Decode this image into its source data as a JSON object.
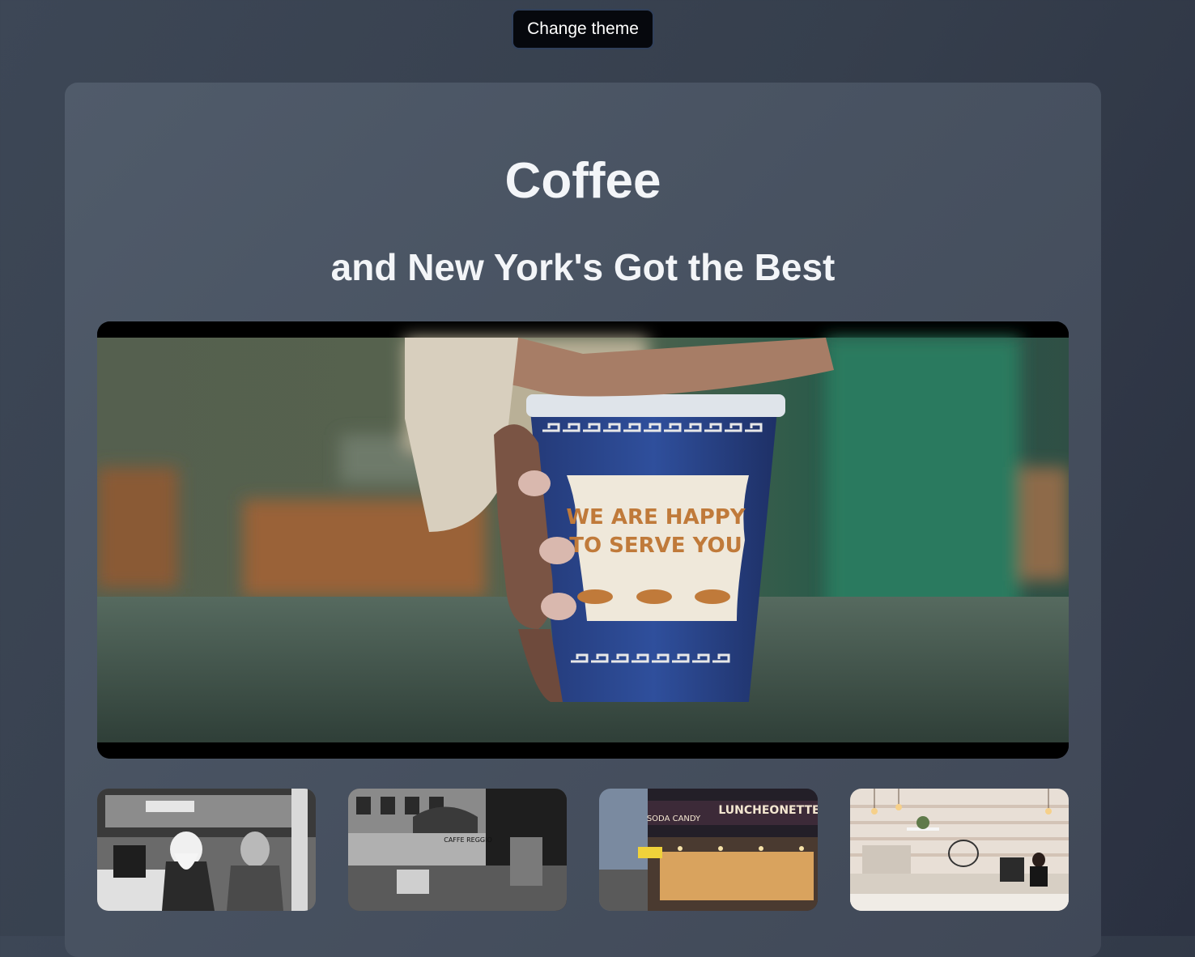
{
  "header": {
    "theme_button_label": "Change theme"
  },
  "main": {
    "title": "Coffee",
    "subtitle": "and New York's Got the Best"
  },
  "hero_photo": {
    "cup_text_line1": "WE ARE HAPPY",
    "cup_text_line2": "TO SERVE YOU"
  },
  "gallery": {
    "thumbnails": [
      {
        "name": "diner-photo"
      },
      {
        "name": "caffe-reggio-street-photo",
        "sign_text": "CAFFE REGGIO"
      },
      {
        "name": "luncheonette-photo",
        "sign_text": "LUNCHEONETTE",
        "sign_text2": "SODA CANDY"
      },
      {
        "name": "cafe-interior-photo"
      }
    ]
  },
  "colors": {
    "background": "#363f4d",
    "card": "#4a5463",
    "text": "#f3f5f8",
    "button": "#06080d"
  }
}
